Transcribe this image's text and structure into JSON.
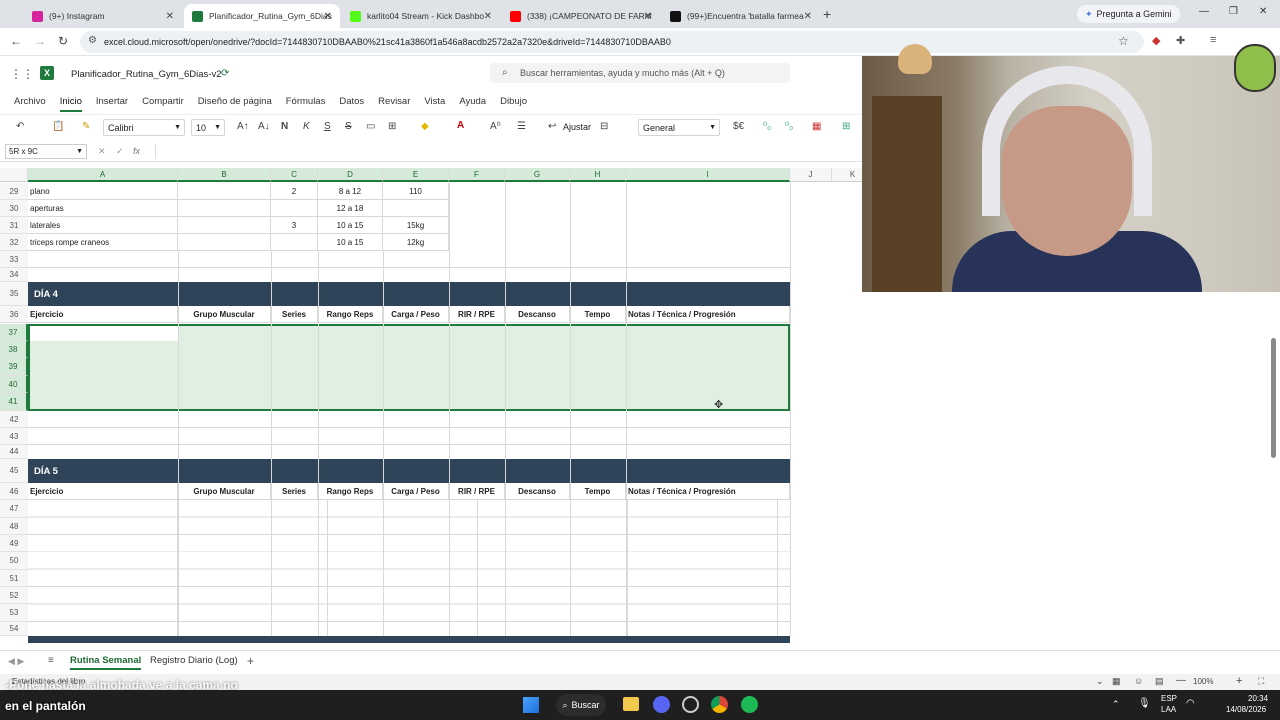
{
  "browser": {
    "tabs": [
      {
        "label": "(9+) Instagram",
        "color": "#d6249f"
      },
      {
        "label": "Planificador_Rutina_Gym_6Dias",
        "color": "#1f7a3e"
      },
      {
        "label": "karlito04 Stream - Kick Dashbo",
        "color": "#53fc18"
      },
      {
        "label": "(338) ¡CAMPEONATO DE FARM",
        "color": "#ff0000"
      },
      {
        "label": "(99+)Encuentra 'batalla farmea",
        "color": "#111111"
      }
    ],
    "gemini_label": "Pregunta a Gemini",
    "url": "excel.cloud.microsoft/open/onedrive/?docId=7144830710DBAAB0%21sc41a3860f1a546a8acdb2572a2a7320e&driveId=7144830710DBAAB0"
  },
  "excel": {
    "file_title": "Planificador_Rutina_Gym_6Dias-v2",
    "search_placeholder": "Buscar herramientas, ayuda y mucho más (Alt + Q)",
    "menu": [
      "Archivo",
      "Inicio",
      "Insertar",
      "Compartir",
      "Diseño de página",
      "Fórmulas",
      "Datos",
      "Revisar",
      "Vista",
      "Ayuda",
      "Dibujo"
    ],
    "active_menu": "Inicio",
    "font_name": "Calibri",
    "font_size": "10",
    "bold_label": "N",
    "italic_label": "K",
    "strike_label": "S",
    "underline_label": "S",
    "wrap_label": "Ajustar",
    "number_format": "General",
    "name_box": "5R x 9C",
    "fx_label": "fx"
  },
  "grid": {
    "columns": [
      "A",
      "B",
      "C",
      "D",
      "E",
      "F",
      "G",
      "H",
      "I",
      "J",
      "K"
    ],
    "rows_top": [
      {
        "num": "29",
        "A": "plano",
        "C": "2",
        "D": "8 a 12",
        "E": "110"
      },
      {
        "num": "30",
        "A": "aperturas",
        "C": "",
        "D": "12 a 18",
        "E": ""
      },
      {
        "num": "31",
        "A": "laterales",
        "C": "3",
        "D": "10 a 15",
        "E": "15kg"
      },
      {
        "num": "32",
        "A": "triceps rompe craneos",
        "C": "",
        "D": "10 a 15",
        "E": "12kg"
      },
      {
        "num": "33"
      },
      {
        "num": "34"
      }
    ],
    "day4": {
      "row": "35",
      "title": "DÍA 4"
    },
    "header_row4": "36",
    "headers": [
      "Ejercicio",
      "Grupo Muscular",
      "Series",
      "Rango Reps",
      "Carga / Peso",
      "RIR / RPE",
      "Descanso",
      "Tempo",
      "Notas / Técnica / Progresión"
    ],
    "rows_mid": [
      "37",
      "38",
      "39",
      "40",
      "41",
      "42",
      "43",
      "44"
    ],
    "day5": {
      "row": "45",
      "title": "DÍA 5"
    },
    "header_row5": "46",
    "rows_bottom": [
      "47",
      "48",
      "49",
      "50",
      "51",
      "52",
      "53",
      "54"
    ]
  },
  "sheets": [
    "Rutina Semanal",
    "Registro Diario (Log)"
  ],
  "active_sheet": "Rutina Semanal",
  "status": {
    "left": "Estadísticas del libro",
    "zoom": "100%"
  },
  "captions": {
    "line1": "-Pone hasta la almohada ve a la cama no",
    "line2": "en el pantalón"
  },
  "taskbar": {
    "search": "Buscar",
    "lang1": "ESP",
    "lang2": "LAA",
    "time": "20:34",
    "date": "14/08/2026"
  }
}
